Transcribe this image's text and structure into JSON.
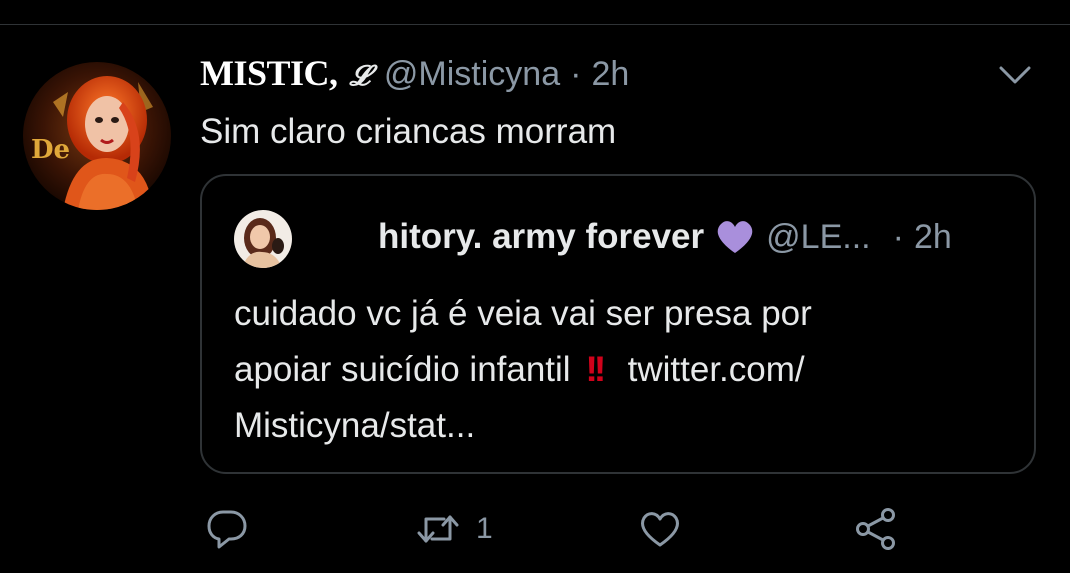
{
  "tweet": {
    "author": {
      "display_name": "MISTIC,",
      "name_glyph": "𝓛",
      "handle": "@Misticyna",
      "separator": "·",
      "time": "2h",
      "avatar_text": "De"
    },
    "text": "Sim claro criancas morram",
    "quoted": {
      "author_name": "hitory. army forever",
      "author_emoji": "purple-heart",
      "handle": "@LE...",
      "separator": "·",
      "time": "2h",
      "text_lines": [
        "cuidado vc já é veia vai ser presa por",
        "apoiar suicídio infantil",
        "Misticyna/stat..."
      ],
      "exclamation": "!!",
      "link_text": "twitter.com/"
    },
    "actions": {
      "reply_icon": "reply-icon",
      "retweet_icon": "retweet-icon",
      "retweet_count": "1",
      "like_icon": "heart-icon",
      "share_icon": "share-icon"
    }
  },
  "colors": {
    "background": "#000000",
    "text_primary": "#e7e9ea",
    "text_secondary": "#8b98a5",
    "border": "#2f3336",
    "purple_heart": "#a98fdc",
    "exclamation": "#d0021b"
  }
}
